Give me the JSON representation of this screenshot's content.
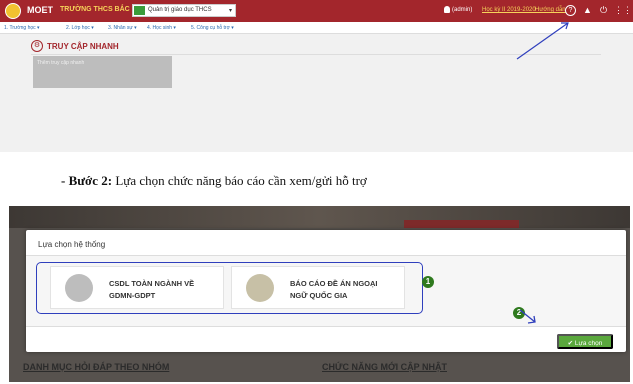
{
  "header": {
    "logo": "MOET",
    "school": "TRƯỜNG THCS BẮC KẠN",
    "role_select": "Quản trị giáo dục THCS",
    "user": "(admin)",
    "year": "Học kỳ II 2019-2020",
    "guide": "Hướng dẫn"
  },
  "menu": [
    "1. Trường học ▾",
    "2. Lớp học ▾",
    "3. Nhân sự ▾",
    "4. Học sinh ▾",
    "5. Công cụ hỗ trợ ▾"
  ],
  "quick_access": {
    "title": "TRUY CẬP NHANH",
    "box_text": "Thêm truy cập nhanh"
  },
  "caption": {
    "step": "- Bước 2:",
    "text": " Lựa chọn chức năng báo cáo cần xem/gửi hỗ trợ"
  },
  "modal": {
    "title": "Lựa chọn hệ thống",
    "card1_line1": "CSDL TOÀN NGÀNH VỀ",
    "card1_line2": "GDMN-GDPT",
    "card2_line1": "BÁO CÁO ĐỀ ÁN NGOẠI",
    "card2_line2": "NGỮ QUỐC GIA",
    "marker1": "1",
    "marker2": "2",
    "ok_button": "Lựa chọn"
  },
  "background_links": {
    "left": "DANH MỤC HỎI ĐÁP THEO NHÓM",
    "right": "CHỨC NĂNG MỚI CẬP NHẬT"
  },
  "colors": {
    "topbar": "#a3262c",
    "highlight": "#2f3fbd",
    "ok": "#5aa83d"
  }
}
